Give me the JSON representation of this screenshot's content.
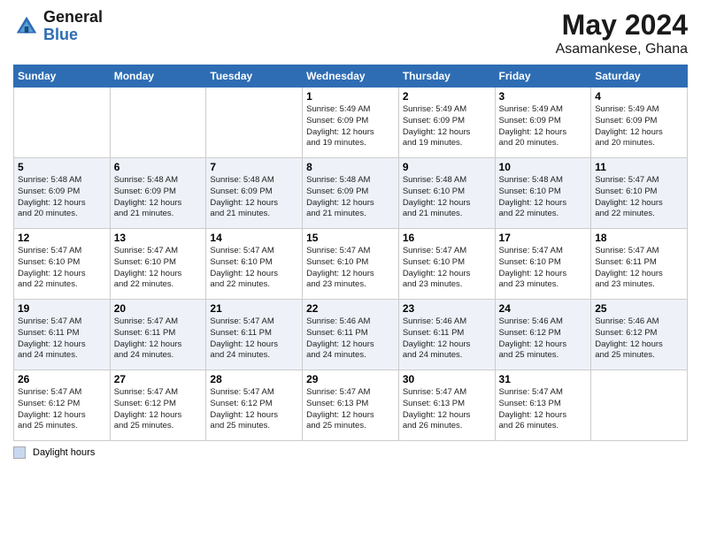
{
  "header": {
    "logo_general": "General",
    "logo_blue": "Blue",
    "month_year": "May 2024",
    "location": "Asamankese, Ghana"
  },
  "footer": {
    "daylight_label": "Daylight hours"
  },
  "days_of_week": [
    "Sunday",
    "Monday",
    "Tuesday",
    "Wednesday",
    "Thursday",
    "Friday",
    "Saturday"
  ],
  "weeks": [
    [
      {
        "day": "",
        "info": ""
      },
      {
        "day": "",
        "info": ""
      },
      {
        "day": "",
        "info": ""
      },
      {
        "day": "1",
        "info": "Sunrise: 5:49 AM\nSunset: 6:09 PM\nDaylight: 12 hours\nand 19 minutes."
      },
      {
        "day": "2",
        "info": "Sunrise: 5:49 AM\nSunset: 6:09 PM\nDaylight: 12 hours\nand 19 minutes."
      },
      {
        "day": "3",
        "info": "Sunrise: 5:49 AM\nSunset: 6:09 PM\nDaylight: 12 hours\nand 20 minutes."
      },
      {
        "day": "4",
        "info": "Sunrise: 5:49 AM\nSunset: 6:09 PM\nDaylight: 12 hours\nand 20 minutes."
      }
    ],
    [
      {
        "day": "5",
        "info": "Sunrise: 5:48 AM\nSunset: 6:09 PM\nDaylight: 12 hours\nand 20 minutes."
      },
      {
        "day": "6",
        "info": "Sunrise: 5:48 AM\nSunset: 6:09 PM\nDaylight: 12 hours\nand 21 minutes."
      },
      {
        "day": "7",
        "info": "Sunrise: 5:48 AM\nSunset: 6:09 PM\nDaylight: 12 hours\nand 21 minutes."
      },
      {
        "day": "8",
        "info": "Sunrise: 5:48 AM\nSunset: 6:09 PM\nDaylight: 12 hours\nand 21 minutes."
      },
      {
        "day": "9",
        "info": "Sunrise: 5:48 AM\nSunset: 6:10 PM\nDaylight: 12 hours\nand 21 minutes."
      },
      {
        "day": "10",
        "info": "Sunrise: 5:48 AM\nSunset: 6:10 PM\nDaylight: 12 hours\nand 22 minutes."
      },
      {
        "day": "11",
        "info": "Sunrise: 5:47 AM\nSunset: 6:10 PM\nDaylight: 12 hours\nand 22 minutes."
      }
    ],
    [
      {
        "day": "12",
        "info": "Sunrise: 5:47 AM\nSunset: 6:10 PM\nDaylight: 12 hours\nand 22 minutes."
      },
      {
        "day": "13",
        "info": "Sunrise: 5:47 AM\nSunset: 6:10 PM\nDaylight: 12 hours\nand 22 minutes."
      },
      {
        "day": "14",
        "info": "Sunrise: 5:47 AM\nSunset: 6:10 PM\nDaylight: 12 hours\nand 22 minutes."
      },
      {
        "day": "15",
        "info": "Sunrise: 5:47 AM\nSunset: 6:10 PM\nDaylight: 12 hours\nand 23 minutes."
      },
      {
        "day": "16",
        "info": "Sunrise: 5:47 AM\nSunset: 6:10 PM\nDaylight: 12 hours\nand 23 minutes."
      },
      {
        "day": "17",
        "info": "Sunrise: 5:47 AM\nSunset: 6:10 PM\nDaylight: 12 hours\nand 23 minutes."
      },
      {
        "day": "18",
        "info": "Sunrise: 5:47 AM\nSunset: 6:11 PM\nDaylight: 12 hours\nand 23 minutes."
      }
    ],
    [
      {
        "day": "19",
        "info": "Sunrise: 5:47 AM\nSunset: 6:11 PM\nDaylight: 12 hours\nand 24 minutes."
      },
      {
        "day": "20",
        "info": "Sunrise: 5:47 AM\nSunset: 6:11 PM\nDaylight: 12 hours\nand 24 minutes."
      },
      {
        "day": "21",
        "info": "Sunrise: 5:47 AM\nSunset: 6:11 PM\nDaylight: 12 hours\nand 24 minutes."
      },
      {
        "day": "22",
        "info": "Sunrise: 5:46 AM\nSunset: 6:11 PM\nDaylight: 12 hours\nand 24 minutes."
      },
      {
        "day": "23",
        "info": "Sunrise: 5:46 AM\nSunset: 6:11 PM\nDaylight: 12 hours\nand 24 minutes."
      },
      {
        "day": "24",
        "info": "Sunrise: 5:46 AM\nSunset: 6:12 PM\nDaylight: 12 hours\nand 25 minutes."
      },
      {
        "day": "25",
        "info": "Sunrise: 5:46 AM\nSunset: 6:12 PM\nDaylight: 12 hours\nand 25 minutes."
      }
    ],
    [
      {
        "day": "26",
        "info": "Sunrise: 5:47 AM\nSunset: 6:12 PM\nDaylight: 12 hours\nand 25 minutes."
      },
      {
        "day": "27",
        "info": "Sunrise: 5:47 AM\nSunset: 6:12 PM\nDaylight: 12 hours\nand 25 minutes."
      },
      {
        "day": "28",
        "info": "Sunrise: 5:47 AM\nSunset: 6:12 PM\nDaylight: 12 hours\nand 25 minutes."
      },
      {
        "day": "29",
        "info": "Sunrise: 5:47 AM\nSunset: 6:13 PM\nDaylight: 12 hours\nand 25 minutes."
      },
      {
        "day": "30",
        "info": "Sunrise: 5:47 AM\nSunset: 6:13 PM\nDaylight: 12 hours\nand 26 minutes."
      },
      {
        "day": "31",
        "info": "Sunrise: 5:47 AM\nSunset: 6:13 PM\nDaylight: 12 hours\nand 26 minutes."
      },
      {
        "day": "",
        "info": ""
      }
    ]
  ]
}
